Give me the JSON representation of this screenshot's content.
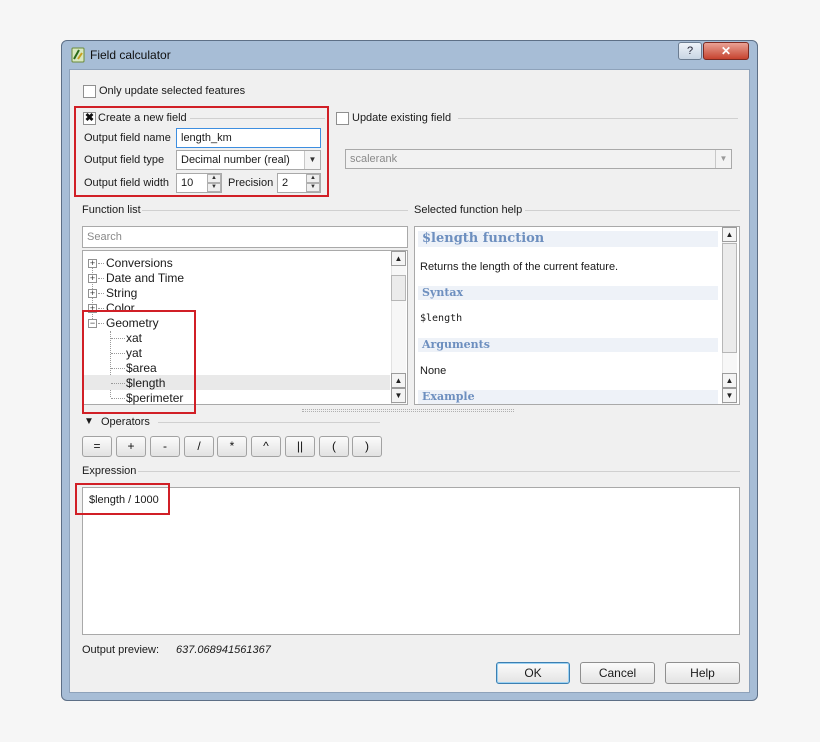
{
  "window": {
    "title": "Field calculator",
    "help_button": "?",
    "close_button": "✕"
  },
  "only_update_selected": {
    "label": "Only update selected features",
    "checked": false
  },
  "create_new_field": {
    "label": "Create a new field",
    "checked": true,
    "output_field_name_label": "Output field name",
    "output_field_name_value": "length_km",
    "output_field_type_label": "Output field type",
    "output_field_type_value": "Decimal number (real)",
    "output_field_width_label": "Output field width",
    "output_field_width_value": "10",
    "precision_label": "Precision",
    "precision_value": "2"
  },
  "update_existing_field": {
    "label": "Update existing field",
    "checked": false,
    "selected_field": "scalerank"
  },
  "function_list": {
    "label": "Function list",
    "search_placeholder": "Search",
    "groups": [
      {
        "label": "Conversions",
        "expander": "+"
      },
      {
        "label": "Date and Time",
        "expander": "+"
      },
      {
        "label": "String",
        "expander": "+"
      },
      {
        "label": "Color",
        "expander": "+"
      },
      {
        "label": "Geometry",
        "expander": "−"
      }
    ],
    "geometry_items": [
      "xat",
      "yat",
      "$area",
      "$length",
      "$perimeter"
    ],
    "selected_item": "$length"
  },
  "selected_function_help": {
    "label": "Selected function help",
    "heading": "$length function",
    "description": "Returns the length of the current feature.",
    "syntax_heading": "Syntax",
    "syntax": "$length",
    "arguments_heading": "Arguments",
    "arguments": "None",
    "example_heading": "Example"
  },
  "operators": {
    "label": "Operators",
    "buttons": [
      "=",
      "+",
      "-",
      "/",
      "*",
      "^",
      "||",
      "(",
      ")"
    ]
  },
  "expression": {
    "label": "Expression",
    "value": "$length / 1000"
  },
  "output_preview": {
    "label": "Output preview:",
    "value": "637.068941561367"
  },
  "buttons": {
    "ok": "OK",
    "cancel": "Cancel",
    "help": "Help"
  },
  "colors": {
    "highlight_box": "#d11f26",
    "help_heading": "#6d8fbf",
    "window_frame": "#a7bdd6"
  }
}
